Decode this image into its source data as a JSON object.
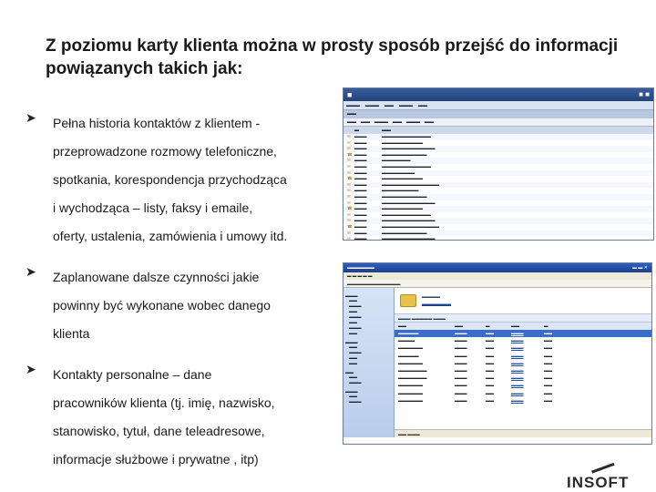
{
  "title": "Z poziomu karty klienta można w prosty sposób przejść do informacji powiązanych takich jak:",
  "bullets": [
    {
      "lines": [
        "Pełna historia kontaktów z klientem -",
        "przeprowadzone rozmowy telefoniczne,",
        "spotkania, korespondencja przychodząca",
        "i wychodząca – listy, faksy i emaile,",
        "oferty, ustalenia, zamówienia i umowy itd."
      ]
    },
    {
      "lines": [
        "Zaplanowane dalsze czynności jakie",
        "powinny być wykonane wobec danego",
        "klienta"
      ]
    },
    {
      "lines": [
        "Kontakty personalne – dane",
        "pracowników klienta (tj. imię, nazwisko,",
        "stanowisko, tytuł, dane teleadresowe,",
        "informacje służbowe i prywatne , itp)"
      ]
    }
  ],
  "logo_text": "INSOFT"
}
